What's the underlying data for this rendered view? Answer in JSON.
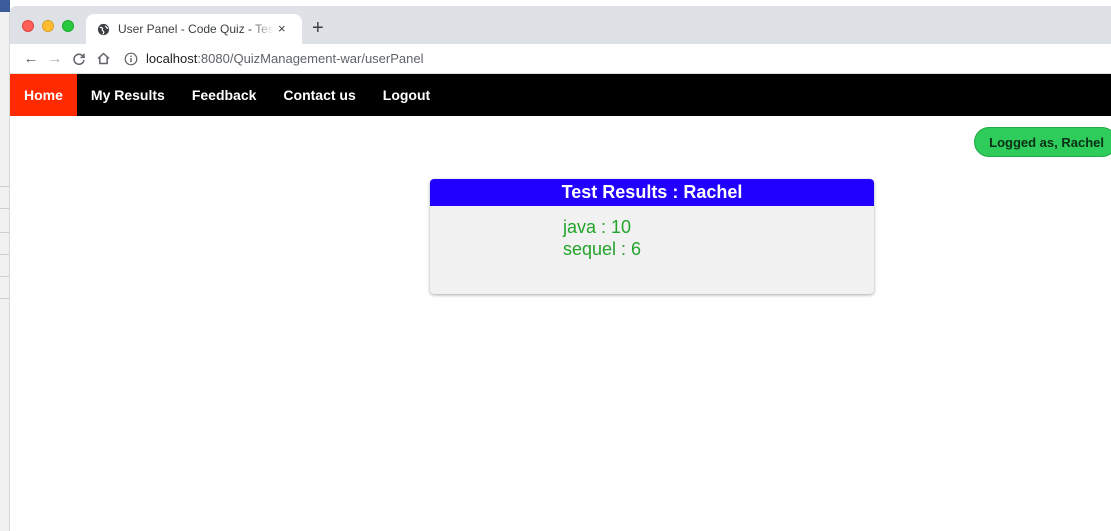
{
  "browser": {
    "tab": {
      "title": "User Panel - Code Quiz - Test You",
      "close_glyph": "×",
      "favicon": "globe-icon"
    },
    "new_tab_glyph": "+",
    "nav": {
      "back_glyph": "←",
      "forward_glyph": "→",
      "reload_glyph": "C",
      "home_glyph": "⌂"
    },
    "address": {
      "host": "localhost",
      "path": ":8080/QuizManagement-war/userPanel"
    }
  },
  "site_nav": {
    "items": [
      {
        "label": "Home",
        "active": true
      },
      {
        "label": "My Results"
      },
      {
        "label": "Feedback"
      },
      {
        "label": "Contact us"
      },
      {
        "label": "Logout"
      }
    ],
    "active_color": "#ff2a00",
    "bar_color": "#000000"
  },
  "user_badge": {
    "text": "Logged as, Rachel",
    "color": "#2ecc5a"
  },
  "results": {
    "title": "Test Results : Rachel",
    "header_color": "#2200ff",
    "entries": [
      {
        "text": "java : 10"
      },
      {
        "text": "sequel : 6"
      }
    ],
    "entry_color": "#22a32a"
  }
}
